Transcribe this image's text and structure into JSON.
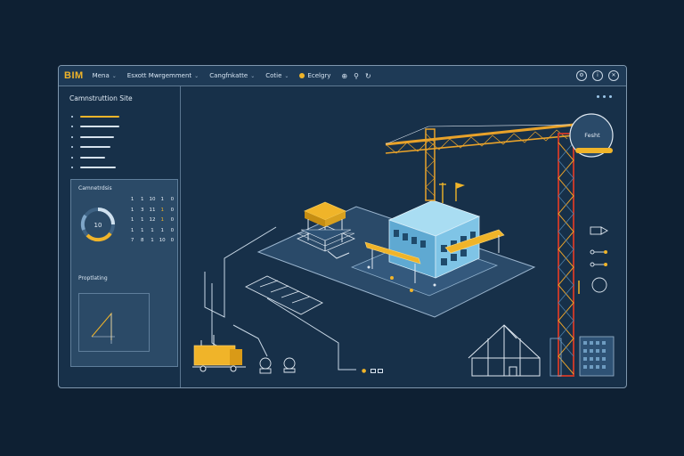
{
  "app": {
    "logo": "BIM",
    "menu": [
      {
        "label": "Mena",
        "chevron": "⌄"
      },
      {
        "label": "Esxott Mwrgemment",
        "chevron": "⌄"
      },
      {
        "label": "Cangfnkatte",
        "chevron": "⌄"
      },
      {
        "label": "Cotie",
        "chevron": "⌄"
      }
    ],
    "tool_label": "Ecelgry",
    "icons": [
      "plus-icon",
      "pin-icon",
      "refresh-icon"
    ],
    "window_controls": [
      "settings-icon",
      "info-icon",
      "close-icon"
    ]
  },
  "sidebar": {
    "title": "Camnstruttion Site",
    "layers": [
      {
        "active": true,
        "width": 0.47
      },
      {
        "active": false,
        "width": 0.47
      },
      {
        "active": false,
        "width": 0.4
      },
      {
        "active": false,
        "width": 0.36
      },
      {
        "active": false,
        "width": 0.3
      },
      {
        "active": false,
        "width": 0.43
      }
    ],
    "overview_label": "Camnetrdsis",
    "gauge_value": "10",
    "calendar": [
      [
        "1",
        "1",
        "10",
        "1",
        "0"
      ],
      [
        "1",
        "3",
        "11",
        "1",
        "0"
      ],
      [
        "1",
        "1",
        "12",
        "1",
        "0"
      ],
      [
        "1",
        "1",
        "1",
        "1",
        "0"
      ],
      [
        "7",
        "8",
        "1",
        "10",
        "0"
      ]
    ],
    "progress_label": "Proptlating"
  },
  "site": {
    "callout_label": "Fesht",
    "bottom_tools": [
      "pin-icon",
      "square-icon",
      "square-icon"
    ]
  },
  "colors": {
    "accent": "#f0b429",
    "background": "#0e2033",
    "panel": "#173049",
    "line": "#dfe8f1",
    "building": "#7fc4e6",
    "crane_red": "#c0392b"
  }
}
